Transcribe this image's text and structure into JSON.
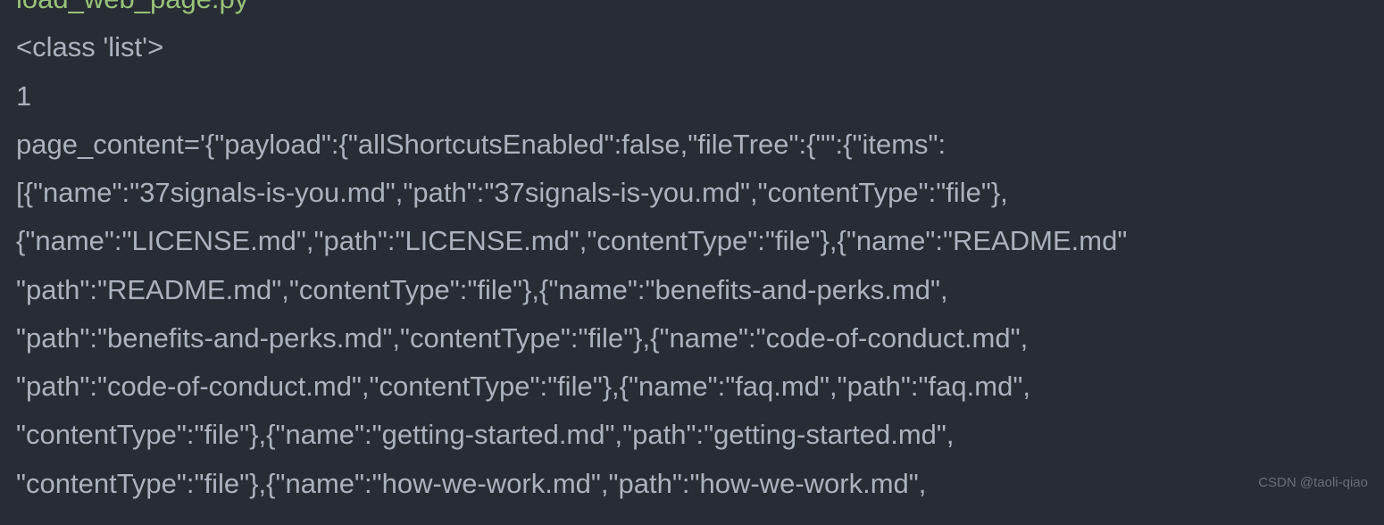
{
  "terminal": {
    "filename": "load_web_page.py",
    "line1": "<class 'list'>",
    "line2": "1",
    "content": "page_content='{\"payload\":{\"allShortcutsEnabled\":false,\"fileTree\":{\"\":{\"items\":\n[{\"name\":\"37signals-is-you.md\",\"path\":\"37signals-is-you.md\",\"contentType\":\"file\"},\n{\"name\":\"LICENSE.md\",\"path\":\"LICENSE.md\",\"contentType\":\"file\"},{\"name\":\"README.md\"\n\"path\":\"README.md\",\"contentType\":\"file\"},{\"name\":\"benefits-and-perks.md\",\n\"path\":\"benefits-and-perks.md\",\"contentType\":\"file\"},{\"name\":\"code-of-conduct.md\",\n\"path\":\"code-of-conduct.md\",\"contentType\":\"file\"},{\"name\":\"faq.md\",\"path\":\"faq.md\",\n\"contentType\":\"file\"},{\"name\":\"getting-started.md\",\"path\":\"getting-started.md\",\n\"contentType\":\"file\"},{\"name\":\"how-we-work.md\",\"path\":\"how-we-work.md\","
  },
  "watermark": "CSDN @taoli-qiao"
}
